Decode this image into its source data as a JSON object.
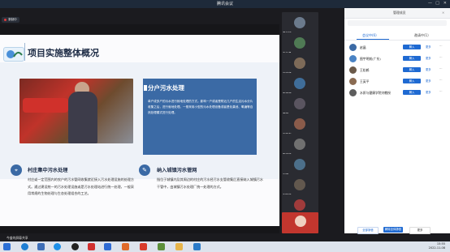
{
  "window": {
    "title": "腾讯会议",
    "controls": [
      "—",
      "□",
      "✕"
    ]
  },
  "left_controls": {
    "record_label": "录制中"
  },
  "slide": {
    "title": "项目实施整体概况",
    "blue_box": {
      "title": "分户污水处理",
      "body": "单户或多户的污水进行就地处理的方式。影响一户或者是附近几户的生活污水分片收集之后，进行就地处理。一般采用小型的污水处理设备或者是化粪池、氧塘等自然处理模式进行处理。"
    },
    "section1": {
      "title": "村庄集中污水处理",
      "body": "村庄或一定范围内的农户的污水管网收集就近接入污水处理设施的处理方式。通过建设统一的污水处理设施或是污水处理站进行统一处理，一般采用常规的生物处理与生态处理组合的工艺。"
    },
    "section2": {
      "title": "纳入城镇污水管网",
      "body": "指位于城镇内及其周边的村庄的污水经污水支管收集后直接纳入城镇污水干管中，由城镇污水处理厂统一处理的方式。"
    }
  },
  "top_caption": "正在讲话：张   超",
  "video_tiles": [
    {
      "name": "李仁敏",
      "color": "#6b7a8c"
    },
    {
      "name": "南仁县",
      "color": "#4f7a54"
    },
    {
      "name": "省宝贤",
      "color": "#7d6a58"
    },
    {
      "name": "张明哲",
      "color": "#3f6d99"
    },
    {
      "name": "周福",
      "color": "#5a5560"
    },
    {
      "name": "万晓东",
      "color": "#8a5b4a"
    },
    {
      "name": "张家华",
      "color": "#707070"
    },
    {
      "name": "倪强",
      "color": "#4c6f8a"
    },
    {
      "name": "刘敏华",
      "color": "#62584e"
    },
    {
      "name": "赵大星",
      "color": "#a03b3b"
    },
    {
      "name": "",
      "color": "#c2362e"
    }
  ],
  "panel": {
    "header_items": [
      "管理成员"
    ],
    "tabs": [
      "会议中(6)",
      "邀请中(1)"
    ],
    "rows": [
      {
        "name": "赵晶",
        "btn": "解入",
        "more": "更多",
        "color": "#3b6aa5"
      },
      {
        "name": "图宇明前(广东)",
        "btn": "解入",
        "more": "更多",
        "color": "#4a83c4"
      },
      {
        "name": "王松鹤",
        "btn": "解入",
        "more": "更多",
        "color": "#6b5a4a"
      },
      {
        "name": "王英平",
        "btn": "解入",
        "more": "更多",
        "color": "#8a6b52"
      },
      {
        "name": "水质与健康学院刘教授",
        "btn": "解入",
        "more": "更多",
        "color": "#5d5d5d"
      }
    ],
    "footer": {
      "mute_all": "全部静音",
      "unmute_all": "解除全体静音",
      "more": "更多"
    }
  },
  "share_bar": "今盛的屏幕共享",
  "tray": {
    "time": "15:55",
    "date": "2022-11-08"
  },
  "colors": {
    "accent": "#1f6ad2",
    "slide_blue": "#3b6aa5"
  }
}
